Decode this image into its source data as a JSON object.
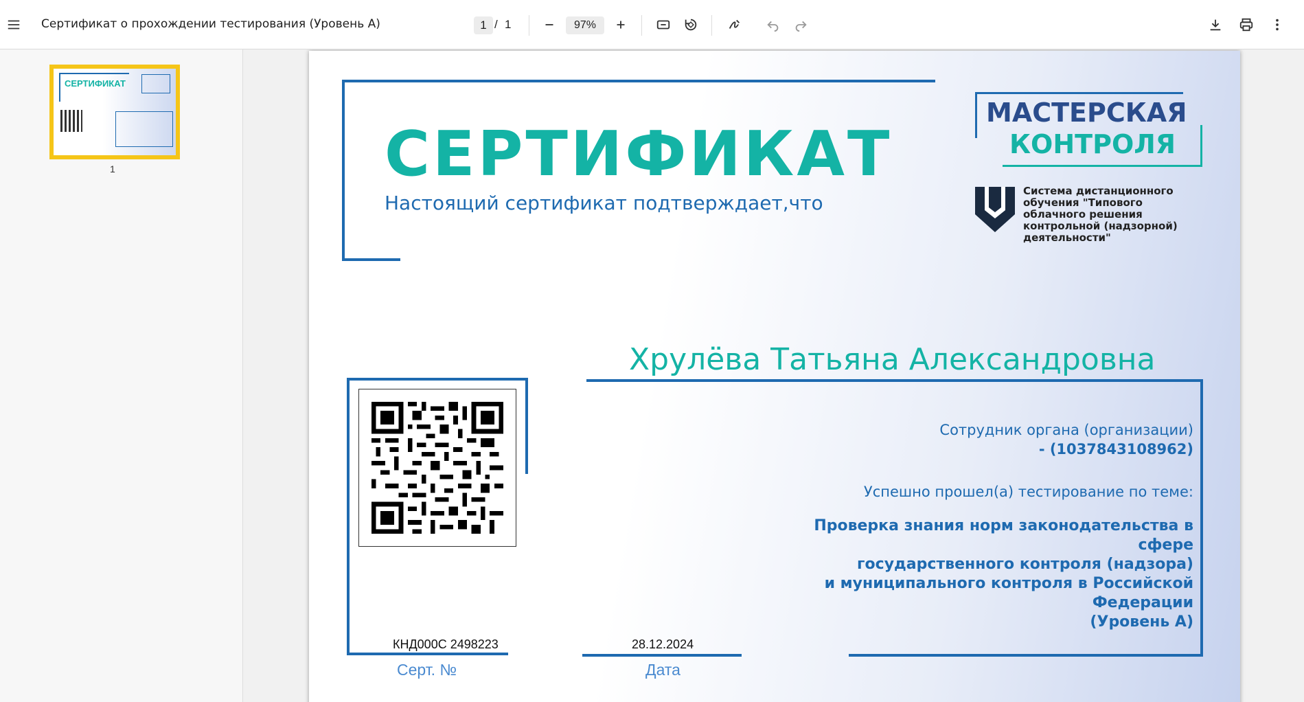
{
  "toolbar": {
    "menu_icon": "hamburger-menu-icon",
    "title": "Сертификат о прохождении тестирования (Уровень А)",
    "page_current": "1",
    "page_separator": "/",
    "page_total": "1",
    "zoom": "97%",
    "icons": [
      "zoom-out-icon",
      "zoom-in-icon",
      "fit-page-icon",
      "rotate-icon",
      "annotate-icon",
      "undo-icon",
      "redo-icon",
      "download-icon",
      "print-icon",
      "more-options-icon"
    ]
  },
  "sidebar": {
    "thumbnail_page": "1",
    "thumbnail_title": "СЕРТИФИКАТ"
  },
  "certificate": {
    "title": "СЕРТИФИКАТ",
    "subtitle": "Настоящий сертификат подтверждает,что",
    "logo_line1": "МАСТЕРСКАЯ",
    "logo_line2": "КОНТРОЛЯ",
    "system_text": "Система дистанционного обучения \"Типового облачного решения контрольной (надзорной) деятельности\"",
    "holder_name": "Хрулёва Татьяна Александровна",
    "role": "Сотрудник органа (организации)",
    "role_id": "- (1037843108962)",
    "passed_text": "Успешно прошел(а) тестирование по теме:",
    "topic_line1": "Проверка знания норм законодательства в сфере",
    "topic_line2": "государственного контроля (надзора)",
    "topic_line3": "и муниципального контроля в Российской Федерации",
    "topic_line4": "(Уровень А)",
    "cert_number": "КНД000С 2498223",
    "cert_number_label": "Серт. №",
    "date": "28.12.2024",
    "date_label": "Дата"
  },
  "colors": {
    "accent_teal": "#14b3a5",
    "accent_blue": "#1e6ab0",
    "thumb_highlight": "#f5c518"
  }
}
